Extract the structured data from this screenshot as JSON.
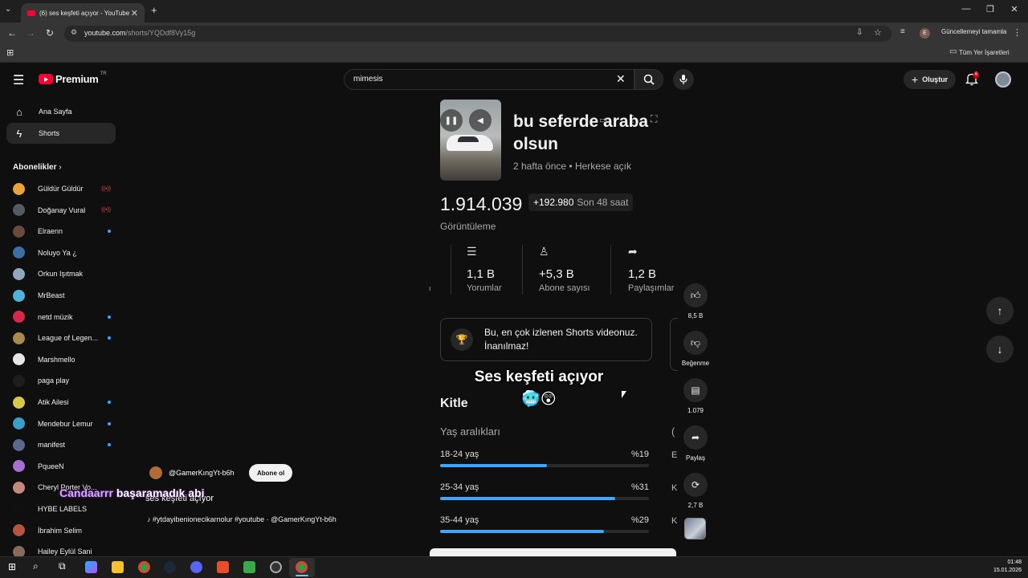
{
  "browser": {
    "tab_title": "(6) ses keşfeti açıyor - YouTube",
    "url_host": "youtube.com",
    "url_path": "/shorts/YQDdf8Vy15g",
    "update_label": "Güncellemeyi tamamla",
    "profile_letter": "E",
    "bookmarks_label": "Tüm Yer İşaretleri"
  },
  "header": {
    "logo_text": "Premium",
    "logo_country": "TR",
    "search_value": "mimesis",
    "create_label": "Oluştur",
    "notification_count": "6"
  },
  "sidebar": {
    "items": [
      {
        "label": "Ana Sayfa",
        "icon": "home-icon"
      },
      {
        "label": "Shorts",
        "icon": "shorts-icon"
      }
    ],
    "subs_title": "Abonelikler",
    "subscriptions": [
      {
        "name": "Güldür Güldür",
        "status": "live",
        "color": "#e8a33c"
      },
      {
        "name": "Doğanay Vural",
        "status": "live",
        "color": "#555b63"
      },
      {
        "name": "Elraenn",
        "status": "dot",
        "color": "#6b4a3c"
      },
      {
        "name": "Noluyo Ya ¿",
        "status": "",
        "color": "#3d6fa3"
      },
      {
        "name": "Orkun Işıtmak",
        "status": "",
        "color": "#8fa7bf"
      },
      {
        "name": "MrBeast",
        "status": "",
        "color": "#4fb3d9"
      },
      {
        "name": "netd müzik",
        "status": "dot",
        "color": "#d6284a"
      },
      {
        "name": "League of Legen...",
        "status": "dot",
        "color": "#a88a4a"
      },
      {
        "name": "Marshmello",
        "status": "",
        "color": "#e6e6e6"
      },
      {
        "name": "paga play",
        "status": "",
        "color": "#1e1e1e"
      },
      {
        "name": "Atik Ailesi",
        "status": "dot",
        "color": "#d9c74a"
      },
      {
        "name": "Mendebur Lemur",
        "status": "dot",
        "color": "#3aa0c8"
      },
      {
        "name": "manifest",
        "status": "dot",
        "color": "#5a6a8a"
      },
      {
        "name": "PqueeN",
        "status": "",
        "color": "#a66fd1"
      },
      {
        "name": "Cheryl Porter Vo...",
        "status": "",
        "color": "#c28a7a"
      },
      {
        "name": "HYBE LABELS",
        "status": "",
        "color": "#101010"
      },
      {
        "name": "İbrahim Selim",
        "status": "",
        "color": "#b5533c"
      },
      {
        "name": "Hailey Eylül Sani",
        "status": "",
        "color": "#8a6a5a"
      }
    ]
  },
  "studio": {
    "title": "bu seferde araba olsun",
    "age": "2 hafta önce",
    "visibility": "Herkese açık",
    "views": "1.914.039",
    "views_delta": "+192.980",
    "views_delta_period": "Son 48 saat",
    "views_label": "Görüntüleme",
    "stats": [
      {
        "value": "1,1 B",
        "label": "Yorumlar",
        "icon": "comment-note-icon"
      },
      {
        "value": "+5,3 B",
        "label": "Abone sayısı",
        "icon": "person-add-icon"
      },
      {
        "value": "1,2 B",
        "label": "Paylaşımlar",
        "icon": "share-icon"
      }
    ],
    "milestone_text": "Bu, en çok izlenen Shorts videonuz. İnanılmaz!",
    "audience_title": "Kitle",
    "age_title": "Yaş aralıkları",
    "age_groups": [
      {
        "range": "18-24 yaş",
        "percent_label": "%19",
        "percent": 19
      },
      {
        "range": "25-34 yaş",
        "percent_label": "%31",
        "percent": 31
      },
      {
        "range": "35-44 yaş",
        "percent_label": "%29",
        "percent": 29
      }
    ]
  },
  "video_overlay": {
    "caption": "Ses keşfeti açıyor🥶😲"
  },
  "actions": {
    "like_count": "8,5 B",
    "dislike_label": "Beğenme",
    "comment_count": "1.079",
    "share_label": "Paylaş",
    "remix_count": "2,7 B"
  },
  "short_info": {
    "channel": "@GamerKıngYt-b6h",
    "subscribe_label": "Abone ol",
    "title": "ses keşfeti açıyor",
    "chat_name": "Candaarrr",
    "chat_message": "başaramadık abi",
    "music": "#ytdayibenionecikarnolur #youtube · @GamerKıngYt-b6h"
  },
  "taskbar": {
    "time": "01:48",
    "date": "15.01.2026"
  }
}
